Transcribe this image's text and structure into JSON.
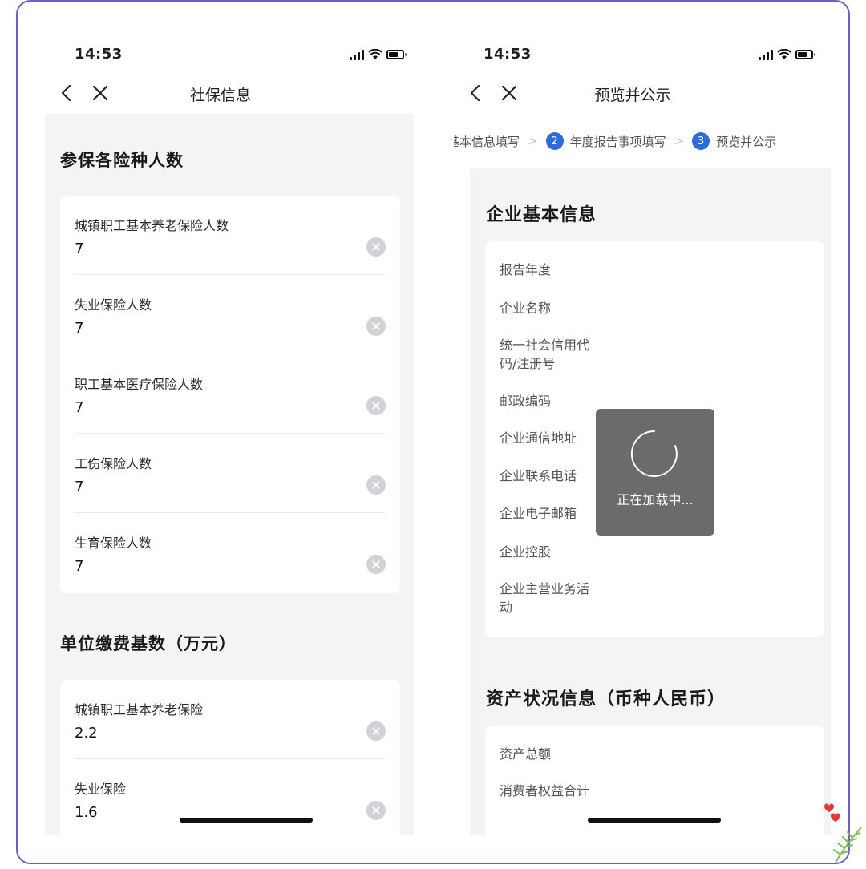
{
  "left_screen": {
    "status": {
      "time": "14:53"
    },
    "nav": {
      "title": "社保信息"
    },
    "section1": {
      "title": "参保各险种人数",
      "fields": [
        {
          "label": "城镇职工基本养老保险人数",
          "value": "7"
        },
        {
          "label": "失业保险人数",
          "value": "7"
        },
        {
          "label": "职工基本医疗保险人数",
          "value": "7"
        },
        {
          "label": "工伤保险人数",
          "value": "7"
        },
        {
          "label": "生育保险人数",
          "value": "7"
        }
      ]
    },
    "section2": {
      "title": "单位缴费基数（万元）",
      "fields": [
        {
          "label": "城镇职工基本养老保险",
          "value": "2.2"
        },
        {
          "label": "失业保险",
          "value": "1.6"
        }
      ]
    }
  },
  "right_screen": {
    "status": {
      "time": "14:53"
    },
    "nav": {
      "title": "预览并公示"
    },
    "stepper": [
      {
        "num": "",
        "label": "基本信息填写"
      },
      {
        "num": "2",
        "label": "年度报告事项填写"
      },
      {
        "num": "3",
        "label": "预览并公示"
      }
    ],
    "section1": {
      "title": "企业基本信息",
      "labels": [
        "报告年度",
        "企业名称",
        "统一社会信用代码/注册号",
        "邮政编码",
        "企业通信地址",
        "企业联系电话",
        "企业电子邮箱",
        "企业控股",
        "企业主营业务活动"
      ]
    },
    "section2": {
      "title": "资产状况信息（币种人民币）",
      "labels": [
        "资产总额",
        "消费者权益合计"
      ]
    },
    "toast": {
      "text": "正在加载中..."
    }
  },
  "colors": {
    "accent": "#2f6bd8",
    "frame": "#6f5fc4",
    "background": "#f3f4f6"
  }
}
